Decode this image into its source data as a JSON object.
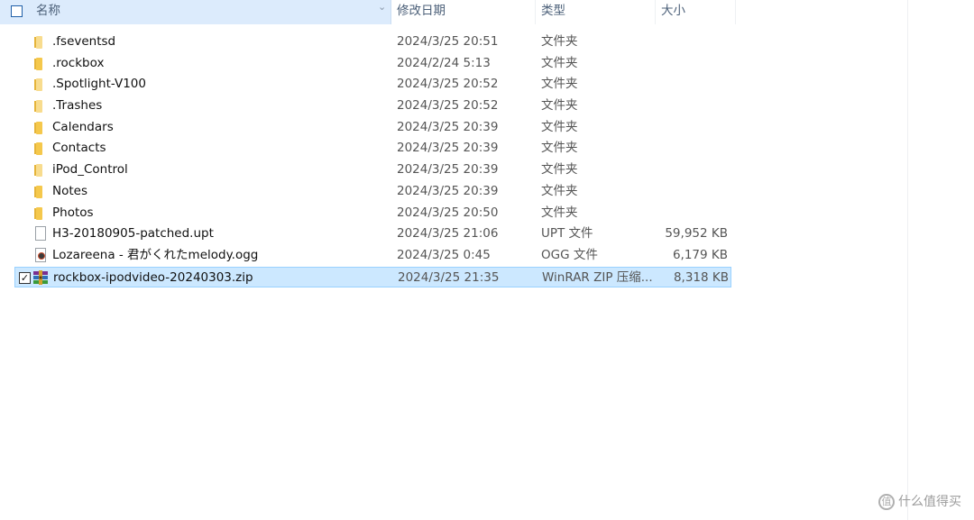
{
  "header": {
    "name_label": "名称",
    "date_label": "修改日期",
    "type_label": "类型",
    "size_label": "大小"
  },
  "files": [
    {
      "name": ".fseventsd",
      "date": "2024/3/25 20:51",
      "type": "文件夹",
      "size": "",
      "icon": "folder-pale-icon"
    },
    {
      "name": ".rockbox",
      "date": "2024/2/24 5:13",
      "type": "文件夹",
      "size": "",
      "icon": "folder-icon"
    },
    {
      "name": ".Spotlight-V100",
      "date": "2024/3/25 20:52",
      "type": "文件夹",
      "size": "",
      "icon": "folder-pale-icon"
    },
    {
      "name": ".Trashes",
      "date": "2024/3/25 20:52",
      "type": "文件夹",
      "size": "",
      "icon": "folder-pale-icon"
    },
    {
      "name": "Calendars",
      "date": "2024/3/25 20:39",
      "type": "文件夹",
      "size": "",
      "icon": "folder-icon"
    },
    {
      "name": "Contacts",
      "date": "2024/3/25 20:39",
      "type": "文件夹",
      "size": "",
      "icon": "folder-icon"
    },
    {
      "name": "iPod_Control",
      "date": "2024/3/25 20:39",
      "type": "文件夹",
      "size": "",
      "icon": "folder-pale-icon"
    },
    {
      "name": "Notes",
      "date": "2024/3/25 20:39",
      "type": "文件夹",
      "size": "",
      "icon": "folder-icon"
    },
    {
      "name": "Photos",
      "date": "2024/3/25 20:50",
      "type": "文件夹",
      "size": "",
      "icon": "folder-icon"
    },
    {
      "name": "H3-20180905-patched.upt",
      "date": "2024/3/25 21:06",
      "type": "UPT 文件",
      "size": "59,952 KB",
      "icon": "document-icon"
    },
    {
      "name": "Lozareena - 君がくれたmelody.ogg",
      "date": "2024/3/25 0:45",
      "type": "OGG 文件",
      "size": "6,179 KB",
      "icon": "audio-file-icon"
    },
    {
      "name": "rockbox-ipodvideo-20240303.zip",
      "date": "2024/3/25 21:35",
      "type": "WinRAR ZIP 压缩...",
      "size": "8,318 KB",
      "icon": "winrar-archive-icon",
      "selected": true
    }
  ],
  "watermark": {
    "text": "什么值得买",
    "icon": "smzdm-logo-icon",
    "icon_glyph": "值"
  },
  "colors": {
    "header_selected_bg": "#dcebfc",
    "row_selected_bg": "#cce8ff",
    "folder": "#f5c84c"
  }
}
